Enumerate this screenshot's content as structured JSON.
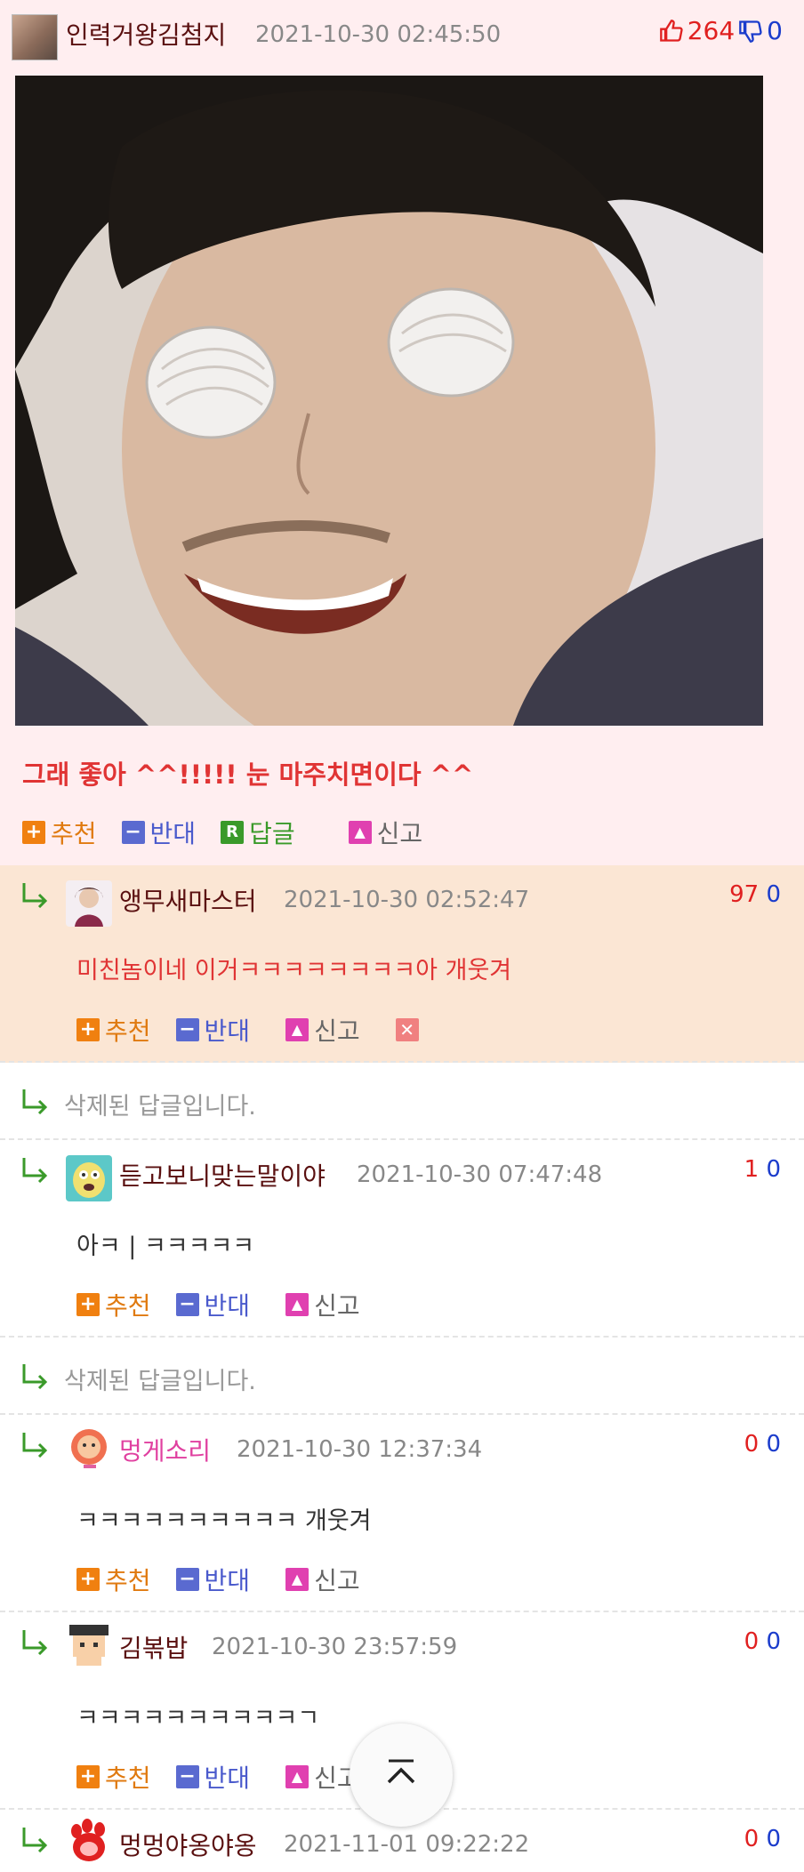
{
  "post": {
    "author": "인력거왕김첨지",
    "time": "2021-10-30 02:45:50",
    "up_count": "264",
    "down_count": "0",
    "text": "그래 좋아 ^^!!!!! 눈 마주치면이다 ^^",
    "actions": {
      "recommend": "추천",
      "oppose": "반대",
      "reply": "답글",
      "report": "신고"
    },
    "reply_badge": "R"
  },
  "comments": [
    {
      "author": "앵무새마스터",
      "time": "2021-10-30 02:52:47",
      "up": "97",
      "down": "0",
      "text": "미친놈이네 이거ㅋㅋㅋㅋㅋㅋㅋㅋ아 개웃겨"
    },
    {
      "deleted": "삭제된 답글입니다."
    },
    {
      "author": "듣고보니맞는말이야",
      "time": "2021-10-30 07:47:48",
      "up": "1",
      "down": "0",
      "text": "아ㅋ | ㅋㅋㅋㅋㅋ"
    },
    {
      "deleted": "삭제된 답글입니다."
    },
    {
      "author": "멍게소리",
      "time": "2021-10-30 12:37:34",
      "up": "0",
      "down": "0",
      "text": "ㅋㅋㅋㅋㅋㅋㅋㅋㅋㅋ 개웃겨"
    },
    {
      "author": "김볶밥",
      "time": "2021-10-30 23:57:59",
      "up": "0",
      "down": "0",
      "text": "ㅋㅋㅋㅋㅋㅋㅋㅋㅋㅋㄱ"
    },
    {
      "author": "멍멍야옹야옹",
      "time": "2021-11-01 09:22:22",
      "up": "0",
      "down": "0"
    }
  ],
  "actions": {
    "recommend": "추천",
    "oppose": "반대",
    "report": "신고"
  },
  "colors": {
    "post_bg": "#ffeef0",
    "highlight_bg": "#fbe6d4",
    "accent_red": "#e03434",
    "down_blue": "#1b3ccc"
  }
}
